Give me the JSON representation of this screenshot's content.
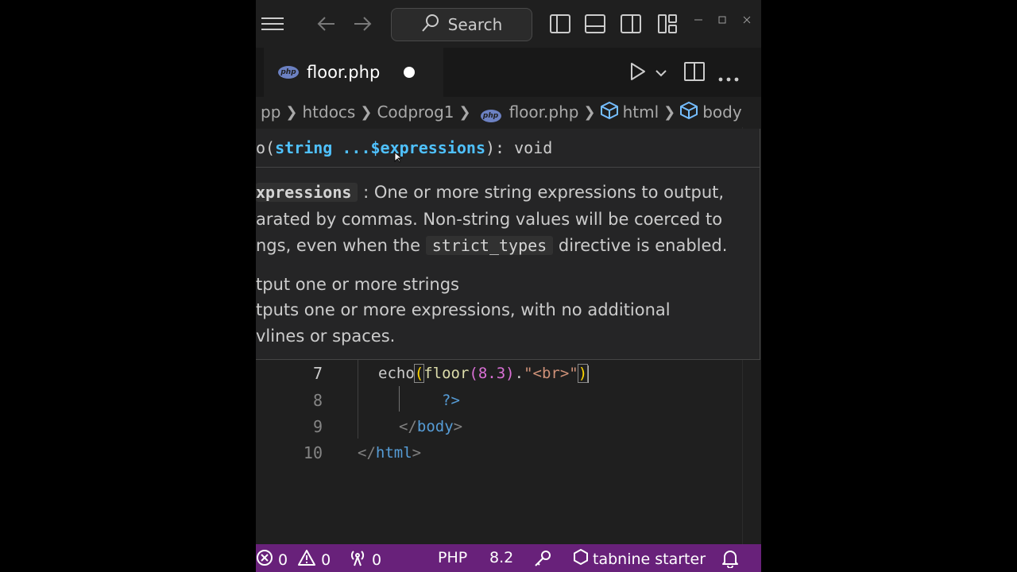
{
  "titlebar": {
    "search_label": "Search"
  },
  "tabs": [
    {
      "label": "floor.php",
      "language_badge": "php",
      "dirty": true
    }
  ],
  "breadcrumb": {
    "items": [
      "pp",
      "htdocs",
      "Codprog1",
      "floor.php",
      "html",
      "body"
    ]
  },
  "hover": {
    "signature": {
      "prefix": "o(",
      "param_type": "string",
      "param_name": " ...$expressions",
      "suffix": "): void"
    },
    "param_doc": {
      "param": "xpressions",
      "line1_rest": " : One or more string expressions to output,",
      "line2": "arated by commas. Non-string values will be coerced to",
      "line3_pre": "ngs, even when the ",
      "line3_code": "strict_types",
      "line3_post": " directive is enabled."
    },
    "summary": "tput one or more strings",
    "description_line1": "tputs one or more expressions, with no additional",
    "description_line2": "vlines or spaces."
  },
  "editor": {
    "lines": [
      {
        "number": "7",
        "tokens": [
          "echo",
          "(",
          "floor",
          "(8.3)",
          ".",
          "\"<br>\"",
          ")"
        ]
      },
      {
        "number": "8",
        "tokens": [
          "?>"
        ]
      },
      {
        "number": "9",
        "tokens": [
          "</",
          "body",
          ">"
        ]
      },
      {
        "number": "10",
        "tokens": [
          "</",
          "html",
          ">"
        ]
      }
    ]
  },
  "statusbar": {
    "errors": "0",
    "warnings": "0",
    "ports": "0",
    "language": "PHP",
    "php_version": "8.2",
    "tabnine": "tabnine starter"
  },
  "colors": {
    "statusbar_bg": "#68217a",
    "keyword_blue": "#569cd6",
    "param_blue": "#4fc1ff",
    "string_orange": "#ce9178",
    "function_yellow": "#dcdcaa",
    "bracket_gold": "#ffd700",
    "bracket_purple": "#da70d6",
    "tag_gray": "#808080",
    "php_badge": "#6c81c2"
  }
}
